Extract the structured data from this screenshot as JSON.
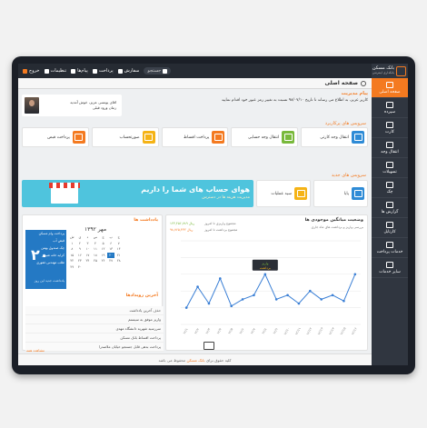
{
  "topbar": {
    "items": [
      {
        "icon": "power-icon",
        "label": "خروج"
      },
      {
        "icon": "gear-icon",
        "label": "تنظیمات"
      },
      {
        "icon": "mail-icon",
        "label": "پیام‌ها"
      },
      {
        "icon": "list-icon",
        "label": "پرداخت"
      },
      {
        "icon": "wallet-icon",
        "label": "سفارش"
      }
    ],
    "search_placeholder": "جستجو",
    "brand_line1": "بانک مسکن",
    "brand_line2": "بانکداری اینترنتی"
  },
  "sidebar": {
    "items": [
      {
        "icon": "home-icon",
        "label": "صفحه اصلی"
      },
      {
        "icon": "deposit-icon",
        "label": "سپرده"
      },
      {
        "icon": "card-icon",
        "label": "کارت"
      },
      {
        "icon": "transfer-icon",
        "label": "انتقال وجه"
      },
      {
        "icon": "loan-icon",
        "label": "تسهیلات"
      },
      {
        "icon": "check-icon",
        "label": "چک"
      },
      {
        "icon": "report-icon",
        "label": "گزارش ها"
      },
      {
        "icon": "cartable-icon",
        "label": "کارتابل"
      },
      {
        "icon": "payment-icon",
        "label": "خدمات پرداخت"
      },
      {
        "icon": "service-icon",
        "label": "سایر خدمات"
      }
    ]
  },
  "page": {
    "title": "صفحه اصلی"
  },
  "user": {
    "name": "اقای یونسی عزیز، خوش آمدید",
    "last_login": "زمان ورود قبلی"
  },
  "message": {
    "title": "پیام مدیریت",
    "body": "کاربر عزیز، به اطلاع می رساند تا تاریخ ۹۸/۰۷/۱۰ نسبت به تغییر رمز عبور خود اقدام نمایید"
  },
  "popular": {
    "title": "سرویس های پرکاربرد",
    "cards": [
      "انتقال وجه کارتی",
      "انتقال وجه حسابی",
      "پرداخت اقساط",
      "صورتحساب",
      "پرداخت قبض"
    ],
    "colors": [
      "#2e8bd6",
      "#79b93c",
      "#f47a20",
      "#f5b316",
      "#f47a20"
    ]
  },
  "new_services": {
    "title": "سرویس های جدید",
    "items": [
      "پایا",
      "سید عملیات"
    ],
    "banner_title": "هوای حساب های شما را داریم",
    "banner_sub": "مدیریت هزینه ها در دسترس"
  },
  "reminders": {
    "title": "یادداشت ها",
    "month": "مهر ۱۳۹۲",
    "day_number": "۲۰",
    "events": [
      "پرداخت وام مسکن",
      "قبض آب",
      "چک صندوق بهمن",
      "کرایه خانه شیراز",
      "طلب مهندس غفوری"
    ],
    "footer": "یادداشت جدید این روز",
    "weekdays": [
      "ش",
      "ی",
      "د",
      "س",
      "چ",
      "پ",
      "ج"
    ],
    "days": [
      "۱",
      "۲",
      "۳",
      "۴",
      "۵",
      "۶",
      "۷",
      "۸",
      "۹",
      "۱۰",
      "۱۱",
      "۱۲",
      "۱۳",
      "۱۴",
      "۱۵",
      "۱۶",
      "۱۷",
      "۱۸",
      "۱۹",
      "۲۰",
      "۲۱",
      "۲۲",
      "۲۳",
      "۲۴",
      "۲۵",
      "۲۶",
      "۲۷",
      "۲۸",
      "۲۹",
      "۳۰"
    ]
  },
  "events": {
    "title": "آخرین رویدادها",
    "items": [
      "حذف آخرین یادداشت",
      "واریز موفق به سیستم",
      "سررسید شهریه دانشگاه مهدی",
      "پرداخت اقساط بانک مسکن",
      "پرداخت بدهی قابل جستجو خیابان ملاصدرا"
    ],
    "more": "مشاهده همه"
  },
  "chart_panel": {
    "title": "وضعیت میانگین موجودی ها",
    "subtitle": "بررسی واریز و برداشت های ماه جاری",
    "legend1": "مجموع واریزی تا امروز",
    "legend1_value": "۱۲۳,۴۵۶,۷۸۹ ریال",
    "legend2": "مجموع برداشت تا امروز",
    "legend2_value": "۹۸,۷۶۵,۴۳۲ ریال",
    "tooltip1": "واریز",
    "tooltip2": "برداشت"
  },
  "chart_data": {
    "type": "line",
    "x": [
      "۱۲/۱",
      "۱۲/۲",
      "۱۲/۳",
      "۱۲/۴",
      "۱۲/۵",
      "۱۲/۶",
      "۱۲/۷",
      "۱۲/۸",
      "۱۲/۹",
      "۱۲/۱۰",
      "۱۲/۱۱",
      "۱۲/۱۲",
      "۱۲/۱۳",
      "۱۲/۱۴",
      "۱۲/۱۵",
      "۱۲/۱۶"
    ],
    "series": [
      {
        "values": [
          20,
          45,
          25,
          55,
          22,
          30,
          35,
          60,
          30,
          35,
          25,
          40,
          30,
          35,
          28,
          60
        ]
      }
    ],
    "ylim": [
      0,
      100
    ],
    "grid": true,
    "color": "#3a7fd5"
  },
  "footer": {
    "prefix": "کلیه حقوق برای",
    "brand": "بانک مسکن",
    "suffix": "محفوظ می باشد"
  }
}
